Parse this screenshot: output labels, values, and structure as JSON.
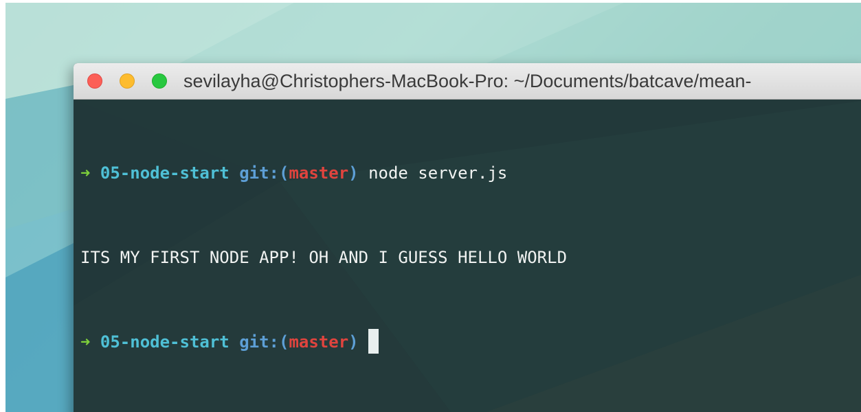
{
  "window": {
    "title": "sevilayha@Christophers-MacBook-Pro: ~/Documents/batcave/mean-"
  },
  "colors": {
    "close": "#fc5f57",
    "minimize": "#fdbc2e",
    "zoom": "#28c840",
    "terminal_bg": "#22393a",
    "prompt_arrow": "#7fd13b",
    "directory": "#4fc0d6",
    "git_label": "#5d9fd6",
    "branch": "#e0443e",
    "text": "#f1f3f2"
  },
  "terminal": {
    "lines": [
      {
        "type": "prompt",
        "arrow": "➜",
        "directory": "05-node-start",
        "git_label": "git:",
        "paren_open": "(",
        "branch": "master",
        "paren_close": ")",
        "command": "node server.js"
      },
      {
        "type": "output",
        "text": "ITS MY FIRST NODE APP! OH AND I GUESS HELLO WORLD"
      },
      {
        "type": "prompt",
        "arrow": "➜",
        "directory": "05-node-start",
        "git_label": "git:",
        "paren_open": "(",
        "branch": "master",
        "paren_close": ")",
        "command": ""
      }
    ]
  }
}
